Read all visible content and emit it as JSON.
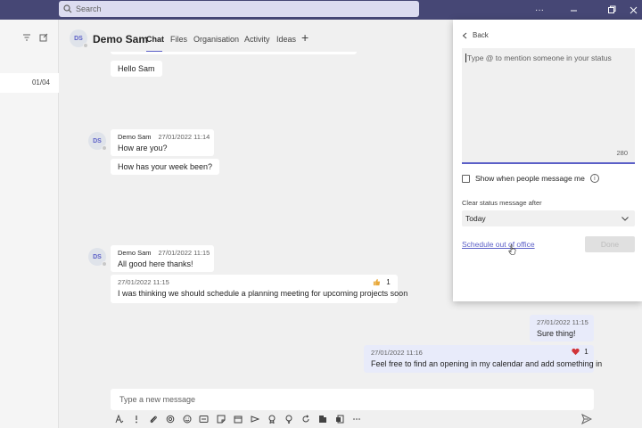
{
  "topbar": {
    "search_placeholder": "Search",
    "ellipsis": "···"
  },
  "leftpane": {
    "chat_date": "01/04"
  },
  "header": {
    "avatar_initials": "DS",
    "name": "Demo Sam",
    "tabs": [
      {
        "label": "Chat"
      },
      {
        "label": "Files"
      },
      {
        "label": "Organisation"
      },
      {
        "label": "Activity"
      },
      {
        "label": "Ideas"
      }
    ],
    "plus": "+"
  },
  "messages": [
    {
      "id": "m0",
      "text": "Hello Sam"
    },
    {
      "id": "m1",
      "sender": "Demo Sam",
      "time": "27/01/2022 11:14",
      "text": "How are you?"
    },
    {
      "id": "m2",
      "text": "How has your week been?"
    },
    {
      "id": "m3",
      "sender": "Demo Sam",
      "time": "27/01/2022 11:15",
      "text": "All good here thanks!"
    },
    {
      "id": "m4",
      "time": "27/01/2022 11:15",
      "text": "I was thinking we should schedule a planning meeting for upcoming projects soon",
      "reaction_count": "1"
    },
    {
      "id": "m5",
      "time": "27/01/2022 11:15",
      "text": "Sure thing!"
    },
    {
      "id": "m6",
      "time": "27/01/2022 11:16",
      "text": "Feel free to find an opening in my calendar and add something in",
      "reaction_count": "1"
    }
  ],
  "avatars": {
    "initials": "DS"
  },
  "compose": {
    "placeholder": "Type a new message"
  },
  "status_panel": {
    "back_label": "Back",
    "placeholder": "Type @ to mention someone in your status",
    "char_count": "280",
    "checkbox_label": "Show when people message me",
    "info_glyph": "i",
    "clear_label": "Clear status message after",
    "clear_value": "Today",
    "schedule_link": "Schedule out of office",
    "done_label": "Done"
  },
  "colors": {
    "topbar": "#464775",
    "accent": "#5b5fc7",
    "self_bubble": "#e8ebfa",
    "heart": "#d13438",
    "thumbs": "#e8a93b"
  }
}
